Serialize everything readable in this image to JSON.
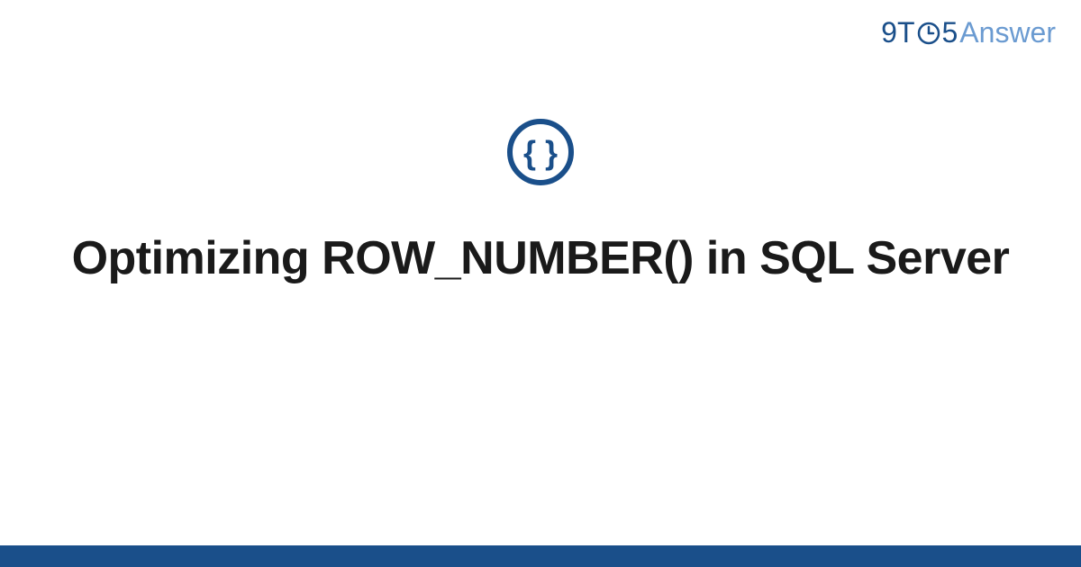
{
  "logo": {
    "part1": "9T",
    "part2": "5",
    "part3": "Answer"
  },
  "title": "Optimizing ROW_NUMBER() in SQL Server",
  "colors": {
    "primary": "#1a4f8a",
    "secondary": "#6b9bd1",
    "iconStroke": "#1a4f8a"
  }
}
